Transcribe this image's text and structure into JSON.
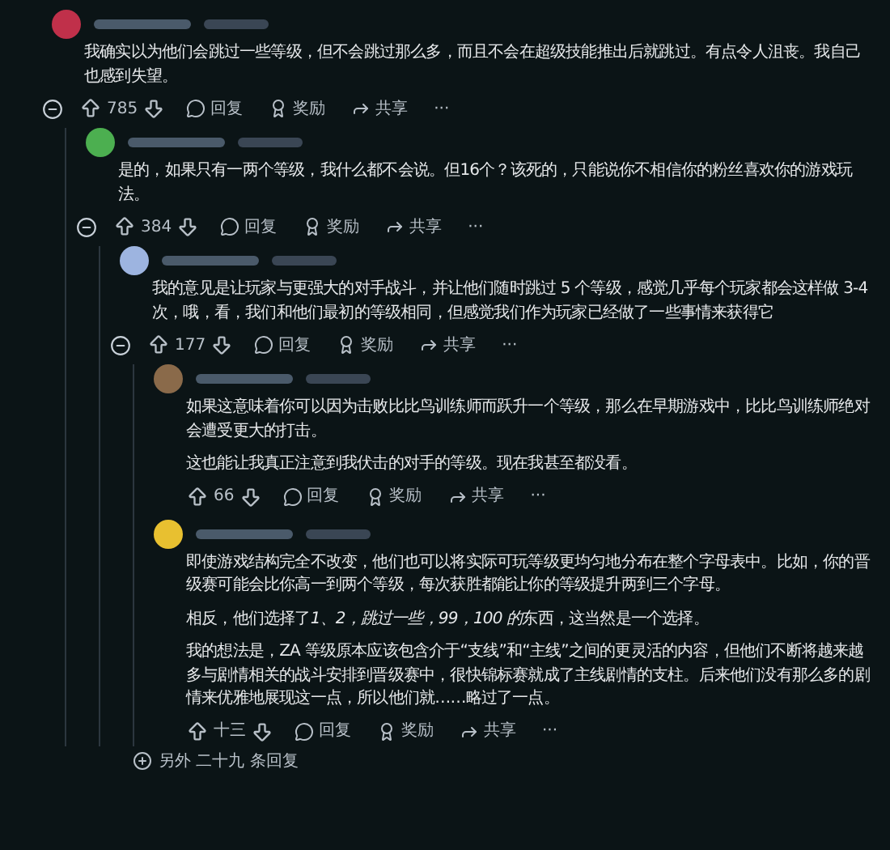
{
  "thread": {
    "comment": {
      "color": "#c0304a",
      "paragraphs": [
        "我确实以为他们会跳过一些等级，但不会跳过那么多，而且不会在超级技能推出后就跳过。有点令人沮丧。我自己也感到失望。"
      ],
      "votes": "785",
      "actions": [
        "回复",
        "奖励",
        "共享",
        "···"
      ],
      "children": [
        {
          "color": "#4caf50",
          "paragraphs": [
            "是的，如果只有一两个等级，我什么都不会说。但16个？该死的，只能说你不相信你的粉丝喜欢你的游戏玩法。"
          ],
          "votes": "384",
          "actions": [
            "回复",
            "奖励",
            "共享",
            "···"
          ],
          "children": [
            {
              "color": "#9db4e0",
              "paragraphs": [
                "我的意见是让玩家与更强大的对手战斗，并让他们随时跳过 5 个等级，感觉几乎每个玩家都会这样做 3-4 次，哦，看，我们和他们最初的等级相同，但感觉我们作为玩家已经做了一些事情来获得它"
              ],
              "votes": "177",
              "actions": [
                "回复",
                "奖励",
                "共享",
                "···"
              ],
              "children": [
                {
                  "color": "#8a6a4a",
                  "paragraphs": [
                    "如果这意味着你可以因为击败比比鸟训练师而跃升一个等级，那么在早期游戏中，比比鸟训练师绝对会遭受更大的打击。",
                    "这也能让我真正注意到我伏击的对手的等级。现在我甚至都没看。"
                  ],
                  "votes": "66",
                  "actions": [
                    "回复",
                    "奖励",
                    "共享",
                    "···"
                  ]
                },
                {
                  "color": "#e8c030",
                  "paragraphs": [
                    "即使游戏结构完全不改变，他们也可以将实际可玩等级更均匀地分布在整个字母表中。比如，你的晋级赛可能会比你高一到两个等级，每次获胜都能让你的等级提升两到三个字母。",
                    [
                      {
                        "text": "相反，他们选择了",
                        "italic": false
                      },
                      {
                        "text": "1、2，跳过一些，99，100 的",
                        "italic": true
                      },
                      {
                        "text": "东西，这当然是一个选择。",
                        "italic": false
                      }
                    ],
                    "我的想法是，ZA 等级原本应该包含介于“支线”和“主线”之间的更灵活的内容，但他们不断将越来越多与剧情相关的战斗安排到晋级赛中，很快锦标赛就成了主线剧情的支柱。后来他们没有那么多的剧情来优雅地展现这一点，所以他们就……略过了一点。"
                  ],
                  "votes": "十三",
                  "actions": [
                    "回复",
                    "奖励",
                    "共享",
                    "···"
                  ]
                }
              ]
            }
          ]
        }
      ]
    },
    "more_replies": "另外 二十九 条回复"
  }
}
